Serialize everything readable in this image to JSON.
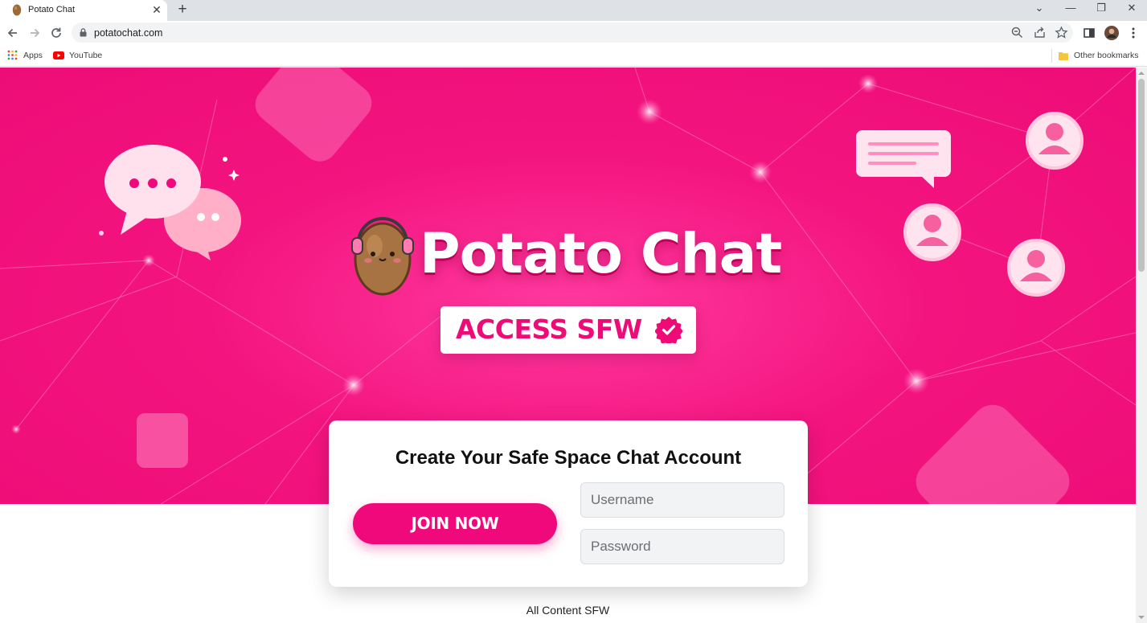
{
  "browser": {
    "tab_title": "Potato Chat",
    "tab_close": "✕",
    "new_tab": "+",
    "url": "potatochat.com",
    "window_controls": {
      "dropdown": "⌄",
      "minimize": "—",
      "restore": "❐",
      "close": "✕"
    },
    "bookmarks": [
      {
        "label": "Apps",
        "icon": "apps-grid-icon"
      },
      {
        "label": "YouTube",
        "icon": "youtube-icon"
      }
    ],
    "other_bookmarks": "Other bookmarks"
  },
  "hero": {
    "title": "Potato Chat",
    "badge": "ACCESS SFW"
  },
  "signup": {
    "title": "Create Your Safe Space Chat Account",
    "join_button": "JOIN NOW",
    "username_placeholder": "Username",
    "password_placeholder": "Password"
  },
  "footer": {
    "note": "All Content SFW"
  },
  "colors": {
    "brand_pink": "#f0097a",
    "hero_bg": "#ee0d77"
  }
}
